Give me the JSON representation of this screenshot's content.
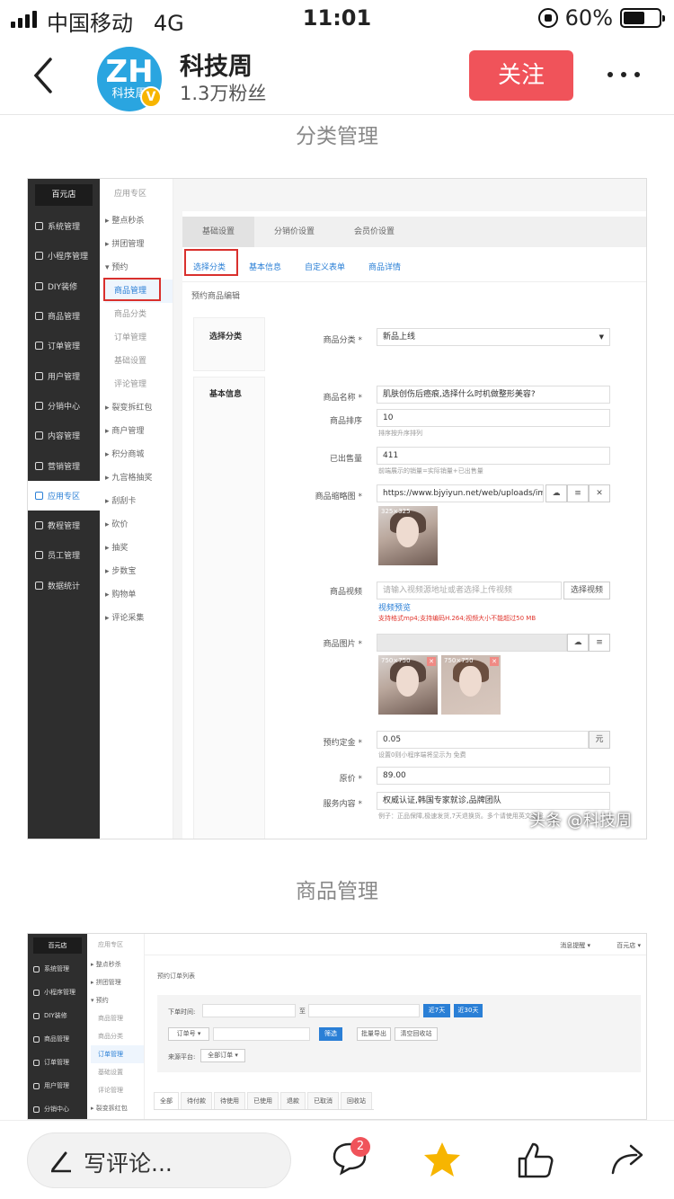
{
  "status": {
    "carrier": "中国移动",
    "network": "4G",
    "time": "11:01",
    "battery": "60%",
    "battery_level": 0.6
  },
  "header": {
    "avatar_text": "ZH",
    "avatar_sub": "科技周",
    "verified": "V",
    "account_name": "科技周",
    "fans": "1.3万粉丝",
    "follow_label": "关注"
  },
  "captions": {
    "first": "分类管理",
    "second": "商品管理"
  },
  "shot1": {
    "brand": "百元店",
    "nav": [
      "系统管理",
      "小程序管理",
      "DIY装修",
      "商品管理",
      "订单管理",
      "用户管理",
      "分销中心",
      "内容管理",
      "营销管理",
      "应用专区",
      "教程管理",
      "员工管理",
      "数据统计"
    ],
    "submenu_title": "应用专区",
    "submenu": [
      "▸ 整点秒杀",
      "▸ 拼团管理",
      "▾ 预约",
      "商品管理",
      "商品分类",
      "订单管理",
      "基础设置",
      "评论管理",
      "▸ 裂变拆红包",
      "▸ 商户管理",
      "▸ 积分商城",
      "▸ 九宫格抽奖",
      "▸ 刮刮卡",
      "▸ 砍价",
      "▸ 抽奖",
      "▸ 步数宝",
      "▸ 购物单",
      "▸ 评论采集"
    ],
    "tabs": [
      "基础设置",
      "分销价设置",
      "会员价设置"
    ],
    "subtabs": [
      "选择分类",
      "基本信息",
      "自定义表单",
      "商品详情"
    ],
    "section_title": "预约商品编辑",
    "choose_category_label": "选择分类",
    "category_field_label": "商品分类 *",
    "category_value": "新品上线",
    "basic_info_label": "基本信息",
    "fields": {
      "name_label": "商品名称 *",
      "name_value": "肌肤创伤后癌痕,选择什么时机做整形美容?",
      "sort_label": "商品排序",
      "sort_value": "10",
      "sort_hint": "排序按升序排列",
      "sold_label": "已出售量",
      "sold_value": "411",
      "sold_hint": "前端展示的销量=实际销量+已出售量",
      "thumb_label": "商品缩略图 *",
      "thumb_url": "https://www.bjyiyun.net/web/uploads/imag",
      "thumb_dim": "325×325",
      "video_label": "商品视频",
      "video_placeholder": "请输入视频源地址或者选择上传视频",
      "video_button": "选择视频",
      "video_preview": "视频预览",
      "video_warn": "支持格式mp4;支持编码H.264;视频大小不能超过50 MB",
      "images_label": "商品图片 *",
      "image_dim_1": "750×750",
      "image_dim_2": "750×750",
      "deposit_label": "预约定金 *",
      "deposit_value": "0.05",
      "deposit_unit": "元",
      "deposit_hint": "设置0则小程序端将显示为 免费",
      "price_label": "原价 *",
      "price_value": "89.00",
      "service_label": "服务内容 *",
      "service_value": "权威认证,韩国专家就诊,品牌团队",
      "service_hint": "例子：正品保障,极速发货,7天退换货。多个请使用英文逗号"
    },
    "watermark": "头条 @科技周"
  },
  "shot2": {
    "brand": "百元店",
    "nav": [
      "系统管理",
      "小程序管理",
      "DIY装修",
      "商品管理",
      "订单管理",
      "用户管理",
      "分销中心"
    ],
    "submenu_title": "应用专区",
    "submenu": [
      "▸ 整点秒杀",
      "▸ 拼团管理",
      "▾ 预约",
      "商品管理",
      "商品分类",
      "订单管理",
      "基础设置",
      "评论管理",
      "▸ 裂变拆红包"
    ],
    "top_right": [
      "消息提醒 ▾",
      "百元店 ▾"
    ],
    "list_title": "预约订单列表",
    "order_time_label": "下单时间:",
    "to": "至",
    "btn_7": "近7天",
    "btn_30": "近30天",
    "order_no": "订单号 ▾",
    "filter_btn": "筛选",
    "export_btn": "批量导出",
    "clear_btn": "清空回收站",
    "source_label": "来源平台:",
    "source_value": "全部订单 ▾",
    "status_tabs": [
      "全部",
      "待付款",
      "待使用",
      "已使用",
      "退款",
      "已取消",
      "回收站"
    ]
  },
  "bottombar": {
    "comment_placeholder": "写评论...",
    "comment_count": "2"
  },
  "colors": {
    "follow": "#f0535a",
    "link": "#2a7fd6",
    "sidebar": "#2e2e2e",
    "star": "#f7b500"
  }
}
